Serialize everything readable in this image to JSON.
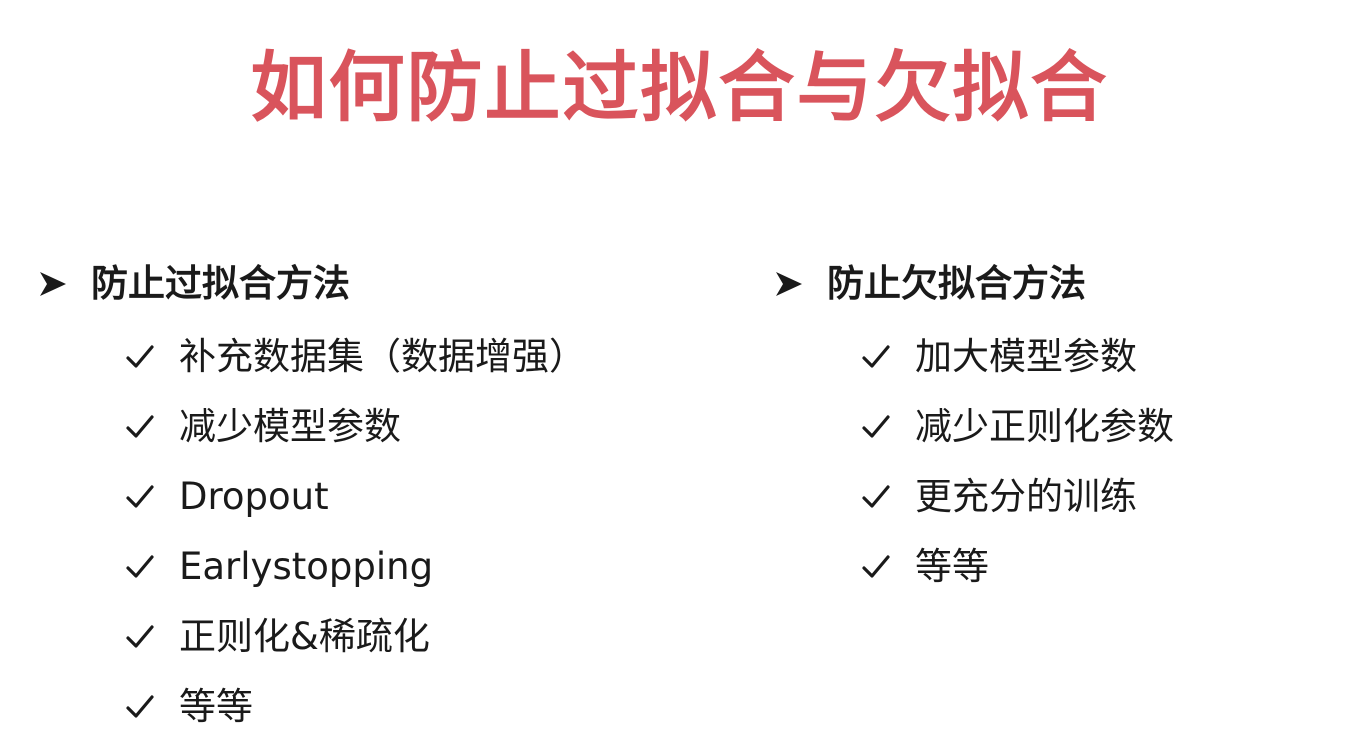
{
  "colors": {
    "title": "#d9545c",
    "text": "#1a1a1a"
  },
  "title": "如何防止过拟合与欠拟合",
  "left": {
    "heading_icon": "arrowhead-bullet-icon",
    "heading": "防止过拟合方法",
    "item_icon": "check-icon",
    "items": [
      "补充数据集（数据增强）",
      "减少模型参数",
      "Dropout",
      "Earlystopping",
      "正则化&稀疏化",
      "等等"
    ]
  },
  "right": {
    "heading_icon": "arrowhead-bullet-icon",
    "heading": "防止欠拟合方法",
    "item_icon": "check-icon",
    "items": [
      "加大模型参数",
      "减少正则化参数",
      "更充分的训练",
      "等等"
    ]
  }
}
